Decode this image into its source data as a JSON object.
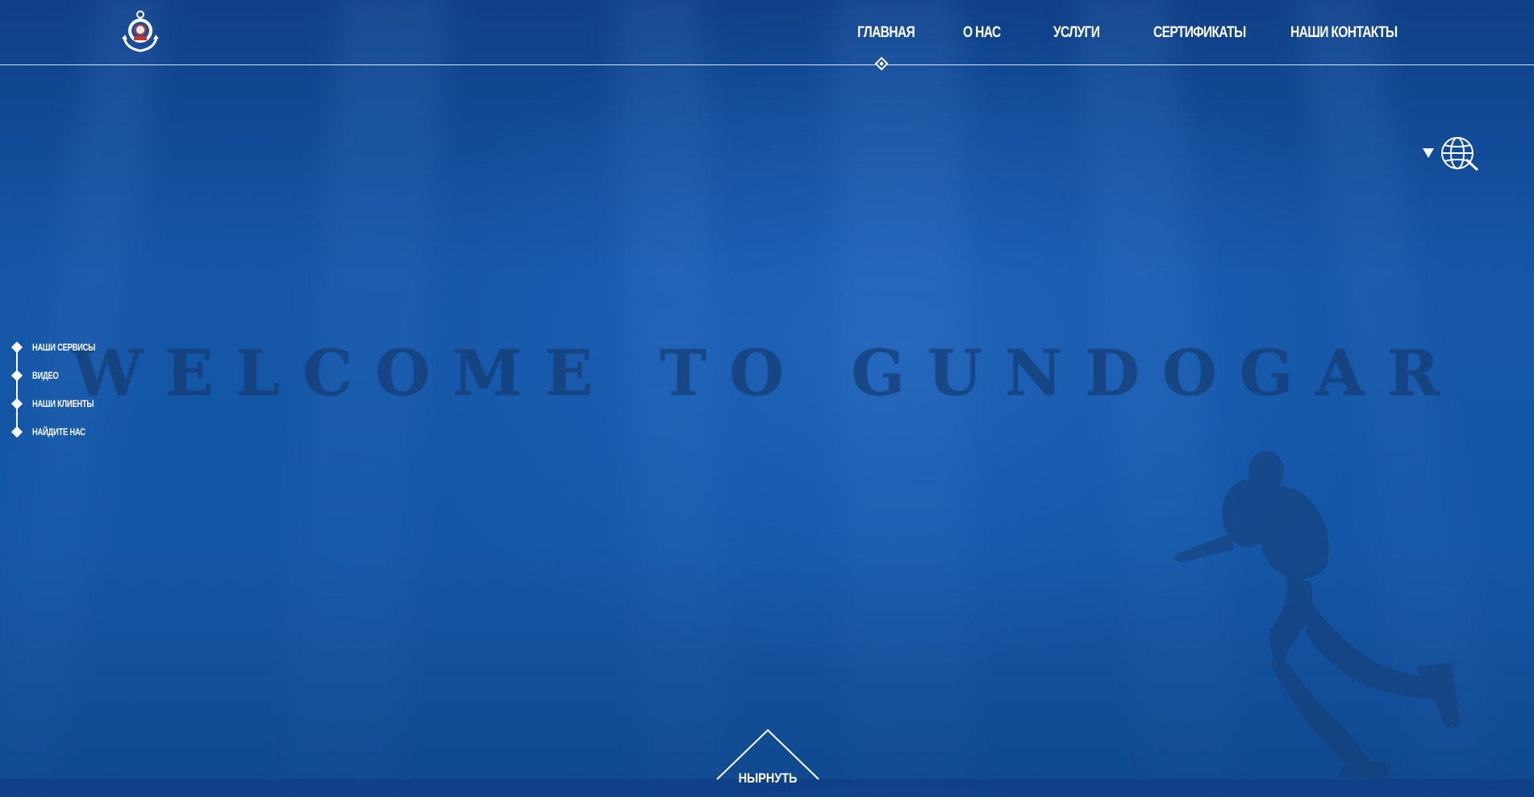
{
  "header": {
    "nav": [
      {
        "label": "ГЛАВНАЯ",
        "active": true
      },
      {
        "label": "О НАС",
        "active": false
      },
      {
        "label": "УСЛУГИ",
        "active": false
      },
      {
        "label": "СЕРТИФИКАТЫ",
        "active": false
      },
      {
        "label": "НАШИ КОНТАКТЫ",
        "active": false
      }
    ],
    "logo_icon": "anchor-diving-helmet-logo",
    "language_icon": "globe-icon",
    "language_toggle_icon": "triangle-down-icon"
  },
  "hero": {
    "title": "WELCOME TO GUNDOGAR",
    "image": "scuba-diver-silhouette"
  },
  "side_nav": {
    "items": [
      {
        "label": "НАШИ СЕРВИСЫ"
      },
      {
        "label": "ВИДЕО"
      },
      {
        "label": "НАШИ КЛИЕНТЫ"
      },
      {
        "label": "НАЙДИТЕ НАС"
      }
    ]
  },
  "scroll_button": {
    "label": "НЫРНУТЬ"
  },
  "colors": {
    "background": "#1556a7",
    "title": "#143d72",
    "text": "#ffffff"
  }
}
